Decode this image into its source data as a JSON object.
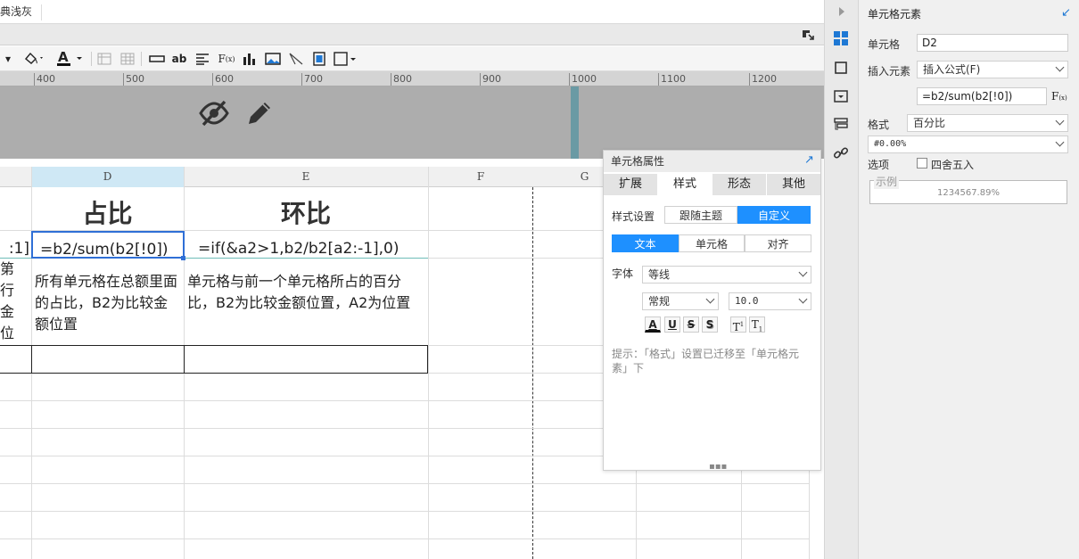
{
  "top_tab": "典浅灰",
  "ruler_ticks": [
    "400",
    "500",
    "600",
    "700",
    "800",
    "900",
    "1000",
    "1100",
    "1200"
  ],
  "columns": {
    "D": "D",
    "E": "E",
    "F": "F",
    "G": "G"
  },
  "cells": {
    "c_row1": "占比",
    "e_row1": "环比",
    "c_row2_left_fragment": ":1]",
    "d_row2": "=b2/sum(b2[!0])",
    "e_row2": "=if(&a2>1,b2/b2[a2:-1],0)",
    "left_fragment_row3": "第行金位",
    "d_row3": "所有单元格在总额里面的占比，B2为比较金额位置",
    "e_row3": "单元格与前一个单元格所占的百分比，B2为比较金额位置，A2为位置"
  },
  "float_panel": {
    "title": "单元格属性",
    "tabs": [
      "扩展",
      "样式",
      "形态",
      "其他"
    ],
    "active_tab": "样式",
    "style_setting_label": "样式设置",
    "style_options": [
      "跟随主题",
      "自定义"
    ],
    "style_active": "自定义",
    "sub_tabs": [
      "文本",
      "单元格",
      "对齐"
    ],
    "sub_active": "文本",
    "font_label": "字体",
    "font_value": "等线",
    "weight_value": "常规",
    "size_value": "10.0",
    "format_buttons": [
      "A",
      "U",
      "S",
      "S",
      "T",
      "T"
    ],
    "hint": "提示：「格式」设置已迁移至「单元格元素」下"
  },
  "right_panel": {
    "title": "单元格元素",
    "cell_label": "单元格",
    "cell_value": "D2",
    "insert_label": "插入元素",
    "insert_value": "插入公式(F)",
    "formula_value": "=b2/sum(b2[!0])",
    "format_label": "格式",
    "format_value": "百分比",
    "pattern_value": "#0.00%",
    "option_label": "选项",
    "round_label": "四舍五入",
    "example_label": "示例",
    "example_value": "1234567.89%"
  },
  "icons": {
    "hide": "eye-slash-icon",
    "edit": "pencil-icon"
  },
  "colors": {
    "accent": "#1e90ff",
    "selection": "#2f6fd6"
  }
}
